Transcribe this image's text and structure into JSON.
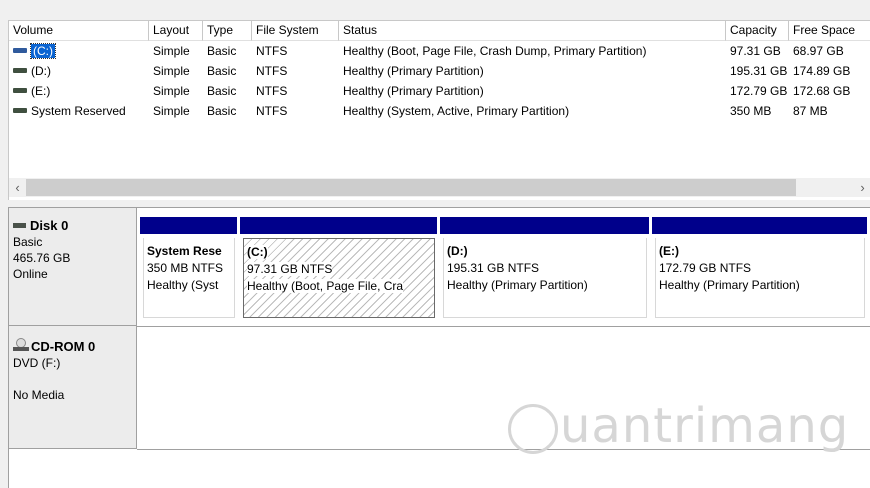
{
  "list": {
    "columns": [
      {
        "key": "volume",
        "label": "Volume"
      },
      {
        "key": "layout",
        "label": "Layout"
      },
      {
        "key": "type",
        "label": "Type"
      },
      {
        "key": "fs",
        "label": "File System"
      },
      {
        "key": "status",
        "label": "Status"
      },
      {
        "key": "capacity",
        "label": "Capacity"
      },
      {
        "key": "free",
        "label": "Free Space"
      }
    ],
    "rows": [
      {
        "volume": "(C:)",
        "layout": "Simple",
        "type": "Basic",
        "fs": "NTFS",
        "status": "Healthy (Boot, Page File, Crash Dump, Primary Partition)",
        "capacity": "97.31 GB",
        "free": "68.97 GB",
        "selected": true
      },
      {
        "volume": "(D:)",
        "layout": "Simple",
        "type": "Basic",
        "fs": "NTFS",
        "status": "Healthy (Primary Partition)",
        "capacity": "195.31 GB",
        "free": "174.89 GB"
      },
      {
        "volume": "(E:)",
        "layout": "Simple",
        "type": "Basic",
        "fs": "NTFS",
        "status": "Healthy (Primary Partition)",
        "capacity": "172.79 GB",
        "free": "172.68 GB"
      },
      {
        "volume": "System Reserved",
        "layout": "Simple",
        "type": "Basic",
        "fs": "NTFS",
        "status": "Healthy (System, Active, Primary Partition)",
        "capacity": "350 MB",
        "free": "87 MB"
      }
    ],
    "scroll_left_icon": "chevron-left-icon",
    "scroll_right_icon": "chevron-right-icon"
  },
  "disks": [
    {
      "name": "Disk 0",
      "kind": "Basic",
      "size": "465.76 GB",
      "state": "Online",
      "partitions": [
        {
          "title": "System Rese",
          "line2": "350 MB NTFS",
          "line3": "Healthy (Syst"
        },
        {
          "title": "(C:)",
          "line2": "97.31 GB NTFS",
          "line3": "Healthy (Boot, Page File, Cra",
          "selected": true
        },
        {
          "title": "(D:)",
          "line2": "195.31 GB NTFS",
          "line3": "Healthy (Primary Partition)"
        },
        {
          "title": "(E:)",
          "line2": "172.79 GB NTFS",
          "line3": "Healthy (Primary Partition)"
        }
      ]
    }
  ],
  "cdrom": {
    "name": "CD-ROM 0",
    "drive": "DVD (F:)",
    "media": "No Media"
  },
  "watermark": "uantrimang",
  "colors": {
    "partition_bar": "#00008b",
    "selection": "#0a64d2"
  }
}
